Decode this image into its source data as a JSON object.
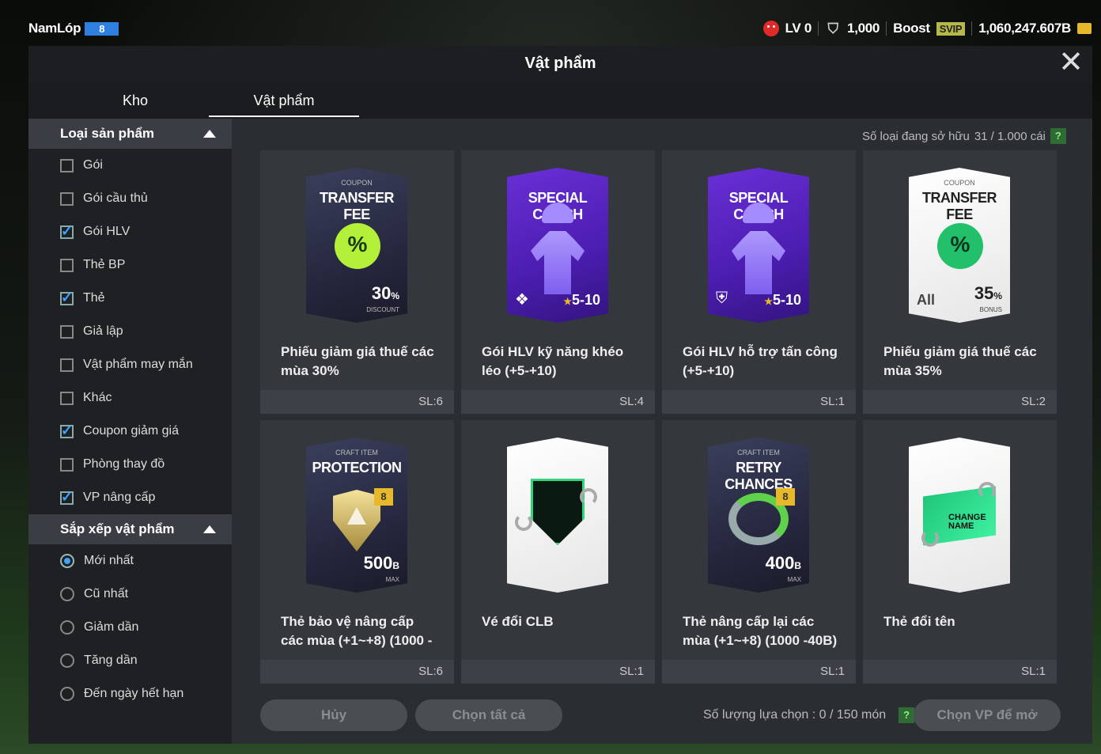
{
  "player": {
    "name": "NamLóp",
    "level": "8"
  },
  "stats": {
    "lv": "LV 0",
    "tokens": "1,000",
    "boost": "Boost",
    "svip": "SVIP",
    "coins": "1,060,247.607B"
  },
  "panel": {
    "title": "Vật phẩm",
    "close": "✕"
  },
  "tabs": [
    {
      "label": "Kho"
    },
    {
      "label": "Vật phẩm",
      "active": true
    }
  ],
  "filters": {
    "type_header": "Loại sản phẩm",
    "types": [
      {
        "label": "Gói",
        "checked": false
      },
      {
        "label": "Gói cầu thủ",
        "checked": false
      },
      {
        "label": "Gói HLV",
        "checked": true
      },
      {
        "label": "Thẻ BP",
        "checked": false
      },
      {
        "label": "Thẻ",
        "checked": true
      },
      {
        "label": "Giả lập",
        "checked": false
      },
      {
        "label": "Vật phẩm may mắn",
        "checked": false
      },
      {
        "label": "Khác",
        "checked": false
      },
      {
        "label": "Coupon giảm giá",
        "checked": true
      },
      {
        "label": "Phòng thay đồ",
        "checked": false
      },
      {
        "label": "VP nâng cấp",
        "checked": true
      }
    ],
    "sort_header": "Sắp xếp vật phẩm",
    "sorts": [
      {
        "label": "Mới nhất",
        "selected": true
      },
      {
        "label": "Cũ nhất",
        "selected": false
      },
      {
        "label": "Giảm dần",
        "selected": false
      },
      {
        "label": "Tăng dần",
        "selected": false
      },
      {
        "label": "Đến ngày hết hạn",
        "selected": false
      }
    ]
  },
  "owned": {
    "label": "Số loại đang sở hữu",
    "value": "31 / 1.000 cái",
    "help": "?"
  },
  "items": [
    {
      "art_small": "COUPON",
      "art_big": "TRANSFER FEE",
      "badge": "%",
      "value": "30",
      "unit": "%",
      "sub": "DISCOUNT",
      "title": "Phiếu giảm giá thuế các mùa 30%",
      "qty": "SL:6"
    },
    {
      "art_big": "SPECIAL COACH",
      "stars": "5-10",
      "title": "Gói HLV kỹ năng khéo léo (+5-+10)",
      "qty": "SL:4"
    },
    {
      "art_big": "SPECIAL COACH",
      "stars": "5-10",
      "title": "Gói HLV hỗ trợ tấn công (+5-+10)",
      "qty": "SL:1"
    },
    {
      "art_small": "COUPON",
      "art_big": "TRANSFER FEE",
      "badge": "%",
      "value": "35",
      "unit": "%",
      "sub": "BONUS",
      "class_label": "All",
      "title": "Phiếu giảm giá thuế các mùa 35%",
      "qty": "SL:2"
    },
    {
      "art_small": "CRAFT ITEM",
      "art_big": "PROTECTION",
      "badge8": "8",
      "value": "500",
      "unit": "B",
      "sub": "MAX",
      "title": "Thẻ bảo vệ nâng cấp các mùa (+1~+8) (1000 -",
      "qty": "SL:6"
    },
    {
      "title": "Vé đổi CLB",
      "qty": "SL:1"
    },
    {
      "art_small": "CRAFT ITEM",
      "art_big": "RETRY CHANCES",
      "badge8": "8",
      "value": "400",
      "unit": "B",
      "sub": "MAX",
      "title": "Thẻ nâng cấp lại các mùa (+1~+8) (1000 -40B)",
      "qty": "SL:1"
    },
    {
      "ticket_text": "CHANGE NAME",
      "title": "Thẻ đổi tên",
      "qty": "SL:1"
    }
  ],
  "bottom": {
    "cancel": "Hủy",
    "select_all": "Chọn tất cả",
    "count_label": "Số lượng lựa chọn : 0 / 150 món",
    "help": "?",
    "open": "Chọn VP để mở"
  },
  "colors": {
    "accent_blue": "#3fa3ff",
    "coupon_lime": "#b4f03a",
    "coach_purple": "#5a26c8",
    "gold": "#e8b82b"
  }
}
